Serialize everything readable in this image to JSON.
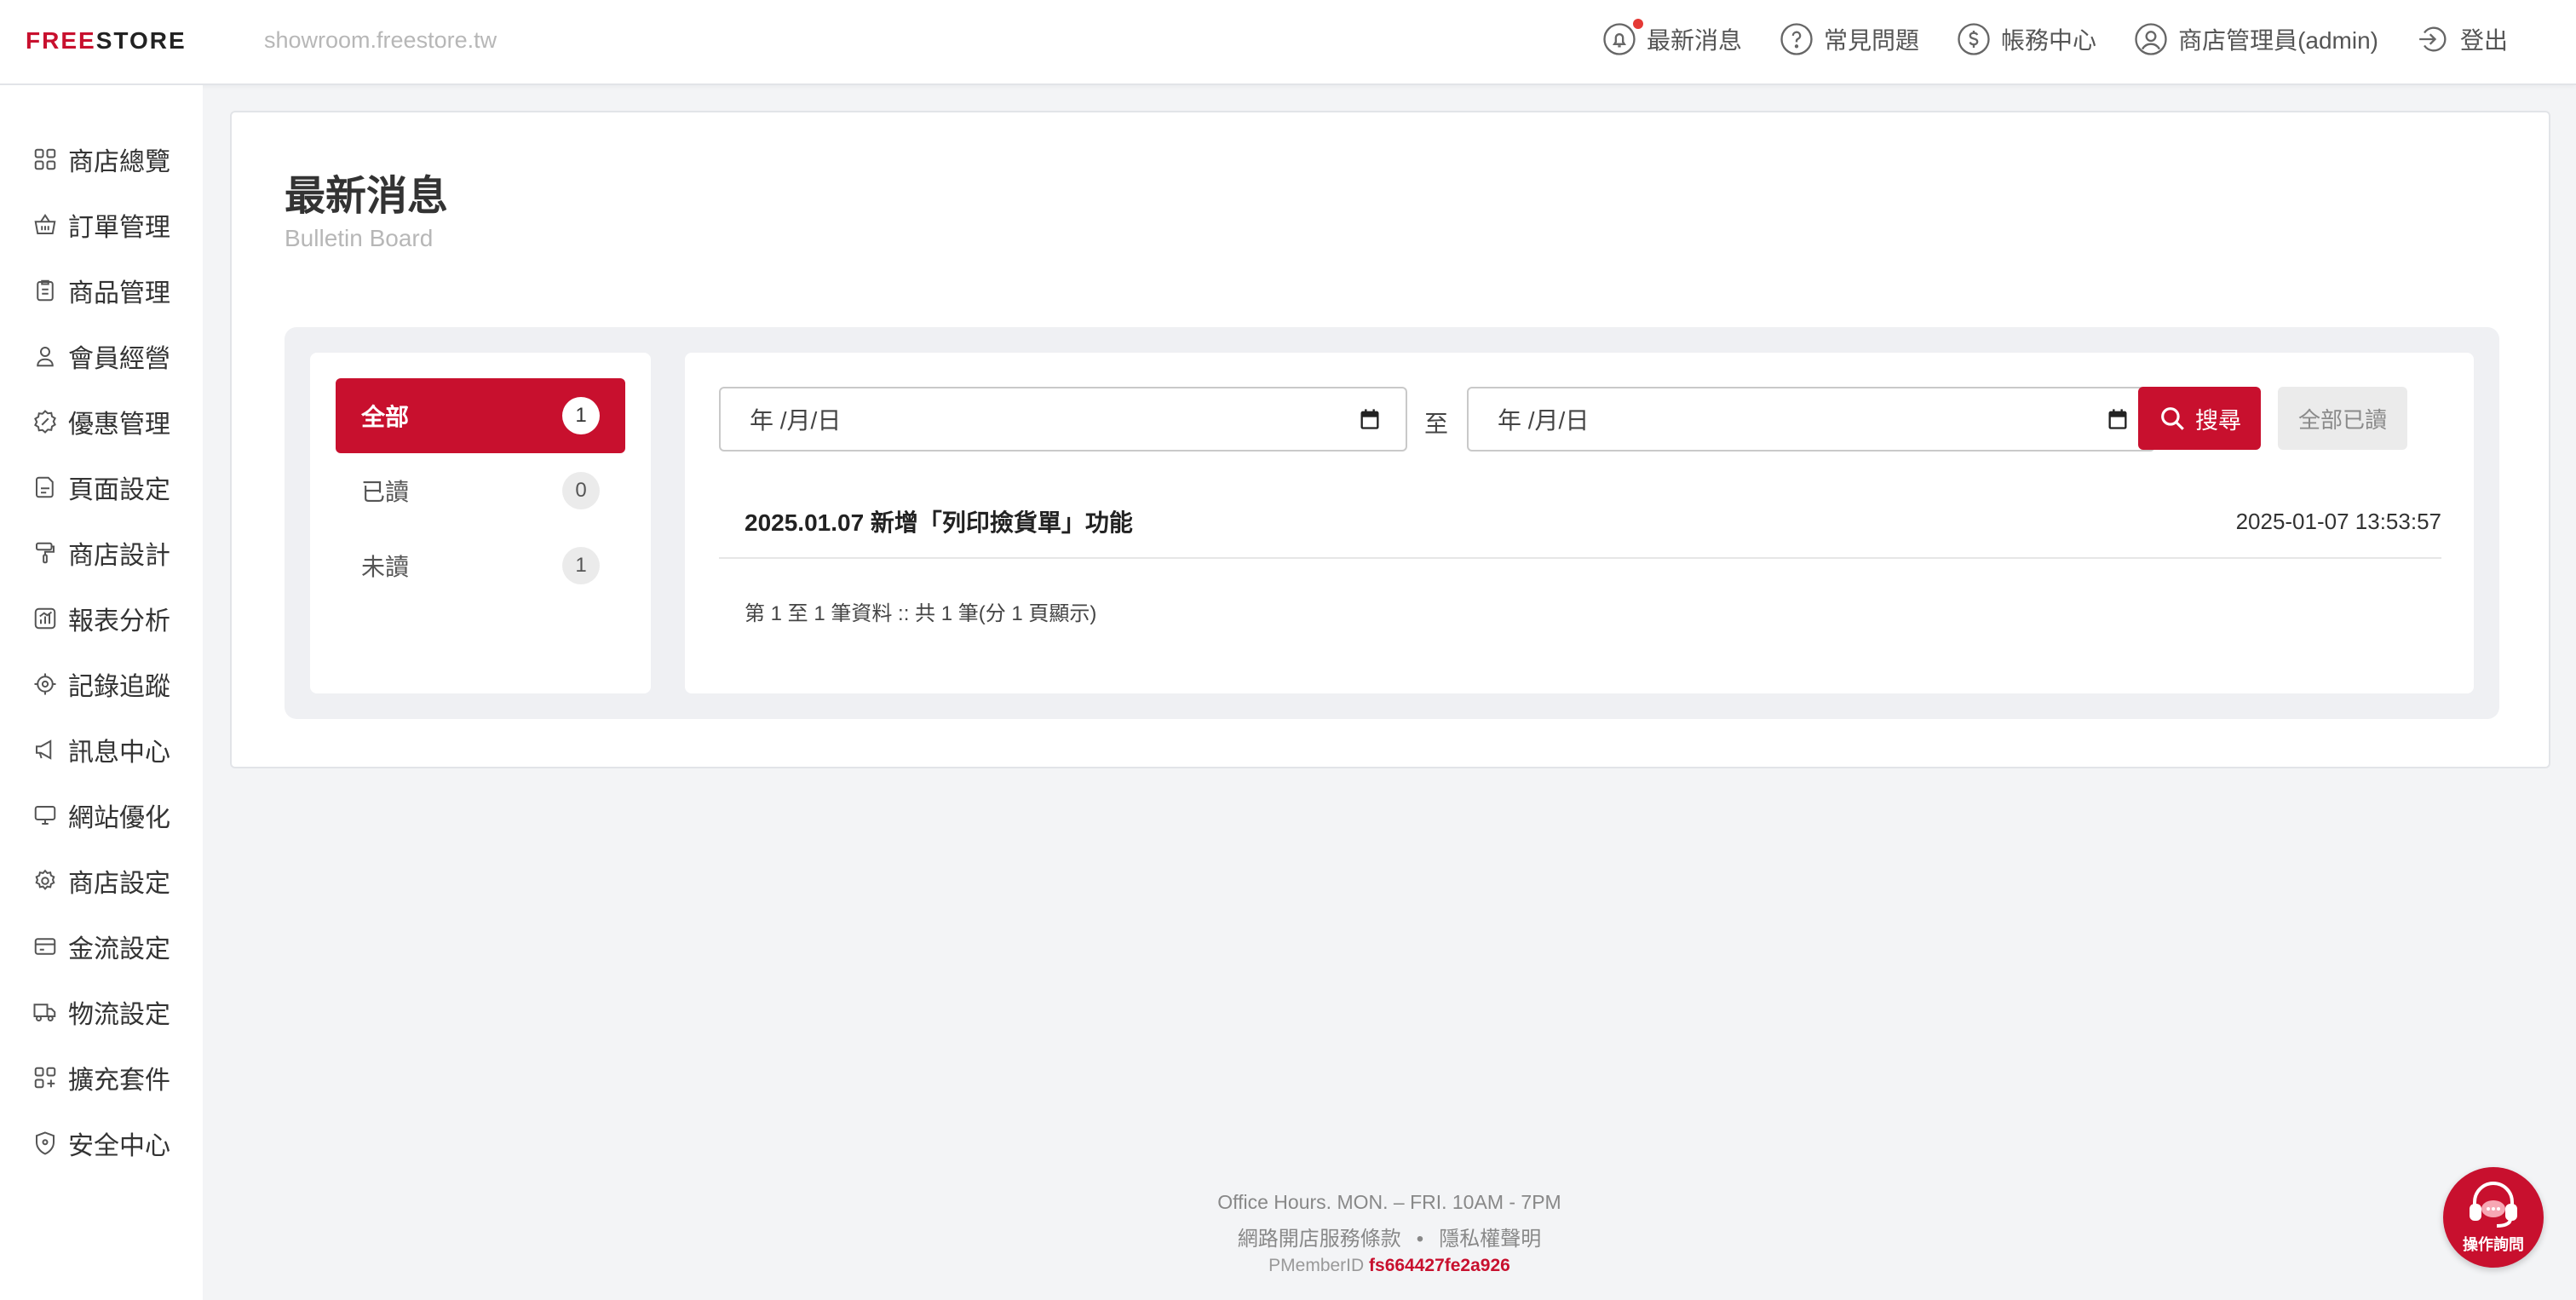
{
  "brand": {
    "logo_free": "FREE",
    "logo_store": "STORE",
    "domain": "showroom.freestore.tw"
  },
  "topnav": {
    "news": "最新消息",
    "faq": "常見問題",
    "billing": "帳務中心",
    "admin": "商店管理員(admin)",
    "logout": "登出"
  },
  "sidebar": {
    "items": [
      {
        "label": "商店總覽",
        "icon": "grid-icon"
      },
      {
        "label": "訂單管理",
        "icon": "basket-icon"
      },
      {
        "label": "商品管理",
        "icon": "clipboard-icon"
      },
      {
        "label": "會員經營",
        "icon": "user-icon"
      },
      {
        "label": "優惠管理",
        "icon": "discount-icon"
      },
      {
        "label": "頁面設定",
        "icon": "file-icon"
      },
      {
        "label": "商店設計",
        "icon": "paint-roller-icon"
      },
      {
        "label": "報表分析",
        "icon": "chart-icon"
      },
      {
        "label": "記錄追蹤",
        "icon": "target-icon"
      },
      {
        "label": "訊息中心",
        "icon": "megaphone-icon"
      },
      {
        "label": "網站優化",
        "icon": "monitor-icon"
      },
      {
        "label": "商店設定",
        "icon": "gear-icon"
      },
      {
        "label": "金流設定",
        "icon": "credit-card-icon"
      },
      {
        "label": "物流設定",
        "icon": "truck-icon"
      },
      {
        "label": "擴充套件",
        "icon": "apps-add-icon"
      },
      {
        "label": "安全中心",
        "icon": "shield-icon"
      }
    ]
  },
  "page": {
    "title": "最新消息",
    "subtitle": "Bulletin Board"
  },
  "filters": [
    {
      "label": "全部",
      "count": "1",
      "active": true
    },
    {
      "label": "已讀",
      "count": "0",
      "active": false
    },
    {
      "label": "未讀",
      "count": "1",
      "active": false
    }
  ],
  "search": {
    "date_from": "年 /月/日",
    "date_to": "年 /月/日",
    "to_label": "至",
    "search_label": "搜尋",
    "read_all_label": "全部已讀"
  },
  "news": [
    {
      "title": "2025.01.07 新增「列印撿貨單」功能",
      "time": "2025-01-07 13:53:57"
    }
  ],
  "pagination_text": "第 1 至 1 筆資料 :: 共 1 筆(分 1 頁顯示)",
  "footer": {
    "hours": "Office Hours.  MON. – FRI.  10AM - 7PM",
    "terms": "網路開店服務條款",
    "separator": "•",
    "privacy": "隱私權聲明",
    "pmember_label": "PMemberID",
    "pmember_id": "fs664427fe2a926"
  },
  "help": {
    "label": "操作詢問"
  },
  "colors": {
    "accent": "#c8102e",
    "background": "#f3f4f6",
    "muted": "#b7b7b7"
  }
}
